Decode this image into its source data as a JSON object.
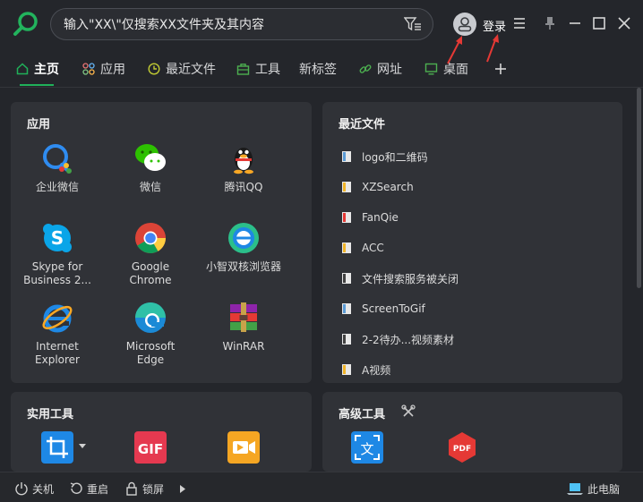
{
  "search": {
    "value": "输入\"XX\\\"仅搜索XX文件夹及其内容"
  },
  "account": {
    "login_label": "登录"
  },
  "tabs": [
    {
      "label": "主页",
      "icon": "home-icon"
    },
    {
      "label": "应用",
      "icon": "apps-icon"
    },
    {
      "label": "最近文件",
      "icon": "clock-icon"
    },
    {
      "label": "工具",
      "icon": "toolbox-icon"
    },
    {
      "label": "新标签"
    },
    {
      "label": "网址",
      "icon": "link-icon"
    },
    {
      "label": "桌面",
      "icon": "monitor-icon"
    }
  ],
  "apps": {
    "title": "应用",
    "items": [
      {
        "label": "企业微信"
      },
      {
        "label": "微信"
      },
      {
        "label": "腾讯QQ"
      },
      {
        "label": "Skype for Business 2..."
      },
      {
        "label": "Google Chrome"
      },
      {
        "label": "小智双核浏览器"
      },
      {
        "label": "Internet Explorer"
      },
      {
        "label": "Microsoft Edge"
      },
      {
        "label": "WinRAR"
      }
    ]
  },
  "recent": {
    "title": "最近文件",
    "items": [
      {
        "label": "logo和二维码"
      },
      {
        "label": "XZSearch"
      },
      {
        "label": "FanQie"
      },
      {
        "label": "ACC"
      },
      {
        "label": "文件搜索服务被关闭"
      },
      {
        "label": "ScreenToGif"
      },
      {
        "label": "2-2待办...视频素材"
      },
      {
        "label": "A视频"
      }
    ]
  },
  "tools": {
    "title": "实用工具"
  },
  "advanced_tools": {
    "title": "高级工具"
  },
  "bottom": {
    "shutdown": "关机",
    "restart": "重启",
    "lock": "锁屏",
    "this_pc": "此电脑"
  },
  "colors": {
    "accent": "#20b15a",
    "background": "#24262b",
    "panel": "#303237"
  }
}
